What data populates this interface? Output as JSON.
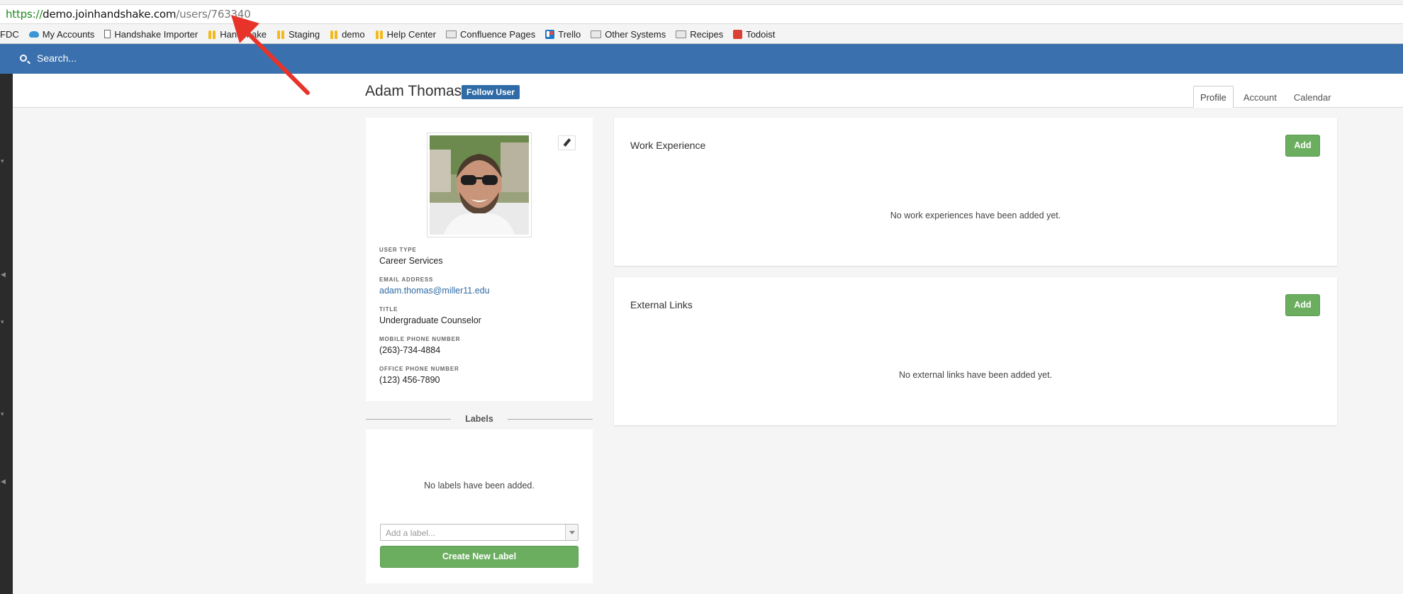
{
  "browser": {
    "url_protocol": "https://",
    "url_host": "demo.joinhandshake.com",
    "url_path": "/users/763340",
    "bookmarks": [
      {
        "label": "FDC",
        "icon": "none"
      },
      {
        "label": "My Accounts",
        "icon": "cloud-icon"
      },
      {
        "label": "Handshake Importer",
        "icon": "file-icon"
      },
      {
        "label": "Handshake",
        "icon": "handshake-icon"
      },
      {
        "label": "Staging",
        "icon": "handshake-icon"
      },
      {
        "label": "demo",
        "icon": "handshake-icon"
      },
      {
        "label": "Help Center",
        "icon": "handshake-icon"
      },
      {
        "label": "Confluence Pages",
        "icon": "folder-icon"
      },
      {
        "label": "Trello",
        "icon": "trello-icon"
      },
      {
        "label": "Other Systems",
        "icon": "folder-icon"
      },
      {
        "label": "Recipes",
        "icon": "folder-icon"
      },
      {
        "label": "Todoist",
        "icon": "todoist-icon"
      }
    ]
  },
  "search": {
    "placeholder": "Search..."
  },
  "header": {
    "user_name": "Adam Thomas",
    "follow_label": "Follow User",
    "tabs": [
      "Profile",
      "Account",
      "Calendar"
    ],
    "active_tab": "Profile"
  },
  "profile": {
    "fields": [
      {
        "label": "USER TYPE",
        "value": "Career Services"
      },
      {
        "label": "EMAIL ADDRESS",
        "value": "adam.thomas@miller11.edu"
      },
      {
        "label": "TITLE",
        "value": "Undergraduate Counselor"
      },
      {
        "label": "MOBILE PHONE NUMBER",
        "value": "(263)-734-4884"
      },
      {
        "label": "OFFICE PHONE NUMBER",
        "value": "(123) 456-7890"
      }
    ]
  },
  "labels": {
    "title": "Labels",
    "empty_text": "No labels have been added.",
    "input_placeholder": "Add a label...",
    "create_label": "Create New Label"
  },
  "work_experience": {
    "title": "Work Experience",
    "add_label": "Add",
    "empty_text": "No work experiences have been added yet."
  },
  "external_links": {
    "title": "External Links",
    "add_label": "Add",
    "empty_text": "No external links have been added yet."
  },
  "colors": {
    "brand_blue": "#3a70ad",
    "green_button": "#6cae60",
    "annotation_red": "#e8332a"
  }
}
